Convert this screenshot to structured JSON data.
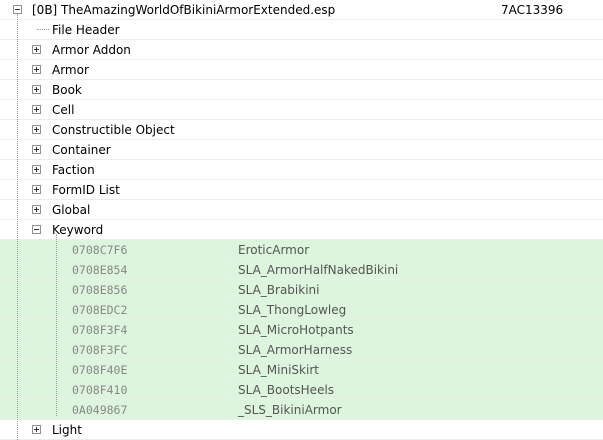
{
  "root": {
    "label": "[0B] TheAmazingWorldOfBikiniArmorExtended.esp",
    "id": "7AC13396"
  },
  "groups": [
    {
      "label": "File Header",
      "expander": "none"
    },
    {
      "label": "Armor Addon",
      "expander": "plus"
    },
    {
      "label": "Armor",
      "expander": "plus"
    },
    {
      "label": "Book",
      "expander": "plus"
    },
    {
      "label": "Cell",
      "expander": "plus"
    },
    {
      "label": "Constructible Object",
      "expander": "plus"
    },
    {
      "label": "Container",
      "expander": "plus"
    },
    {
      "label": "Faction",
      "expander": "plus"
    },
    {
      "label": "FormID List",
      "expander": "plus"
    },
    {
      "label": "Global",
      "expander": "plus"
    },
    {
      "label": "Keyword",
      "expander": "minus"
    }
  ],
  "keywords": [
    {
      "formid": "0708C7F6",
      "edid": "EroticArmor"
    },
    {
      "formid": "0708E854",
      "edid": "SLA_ArmorHalfNakedBikini"
    },
    {
      "formid": "0708E856",
      "edid": "SLA_Brabikini"
    },
    {
      "formid": "0708EDC2",
      "edid": "SLA_ThongLowleg"
    },
    {
      "formid": "0708F3F4",
      "edid": "SLA_MicroHotpants"
    },
    {
      "formid": "0708F3FC",
      "edid": "SLA_ArmorHarness"
    },
    {
      "formid": "0708F40E",
      "edid": "SLA_MiniSkirt"
    },
    {
      "formid": "0708F410",
      "edid": "SLA_BootsHeels"
    },
    {
      "formid": "0A049867",
      "edid": "_SLS_BikiniArmor"
    }
  ],
  "after": [
    {
      "label": "Light",
      "expander": "plus"
    }
  ],
  "colors": {
    "highlight": "#dcf5dc",
    "formid_text": "#888888"
  }
}
